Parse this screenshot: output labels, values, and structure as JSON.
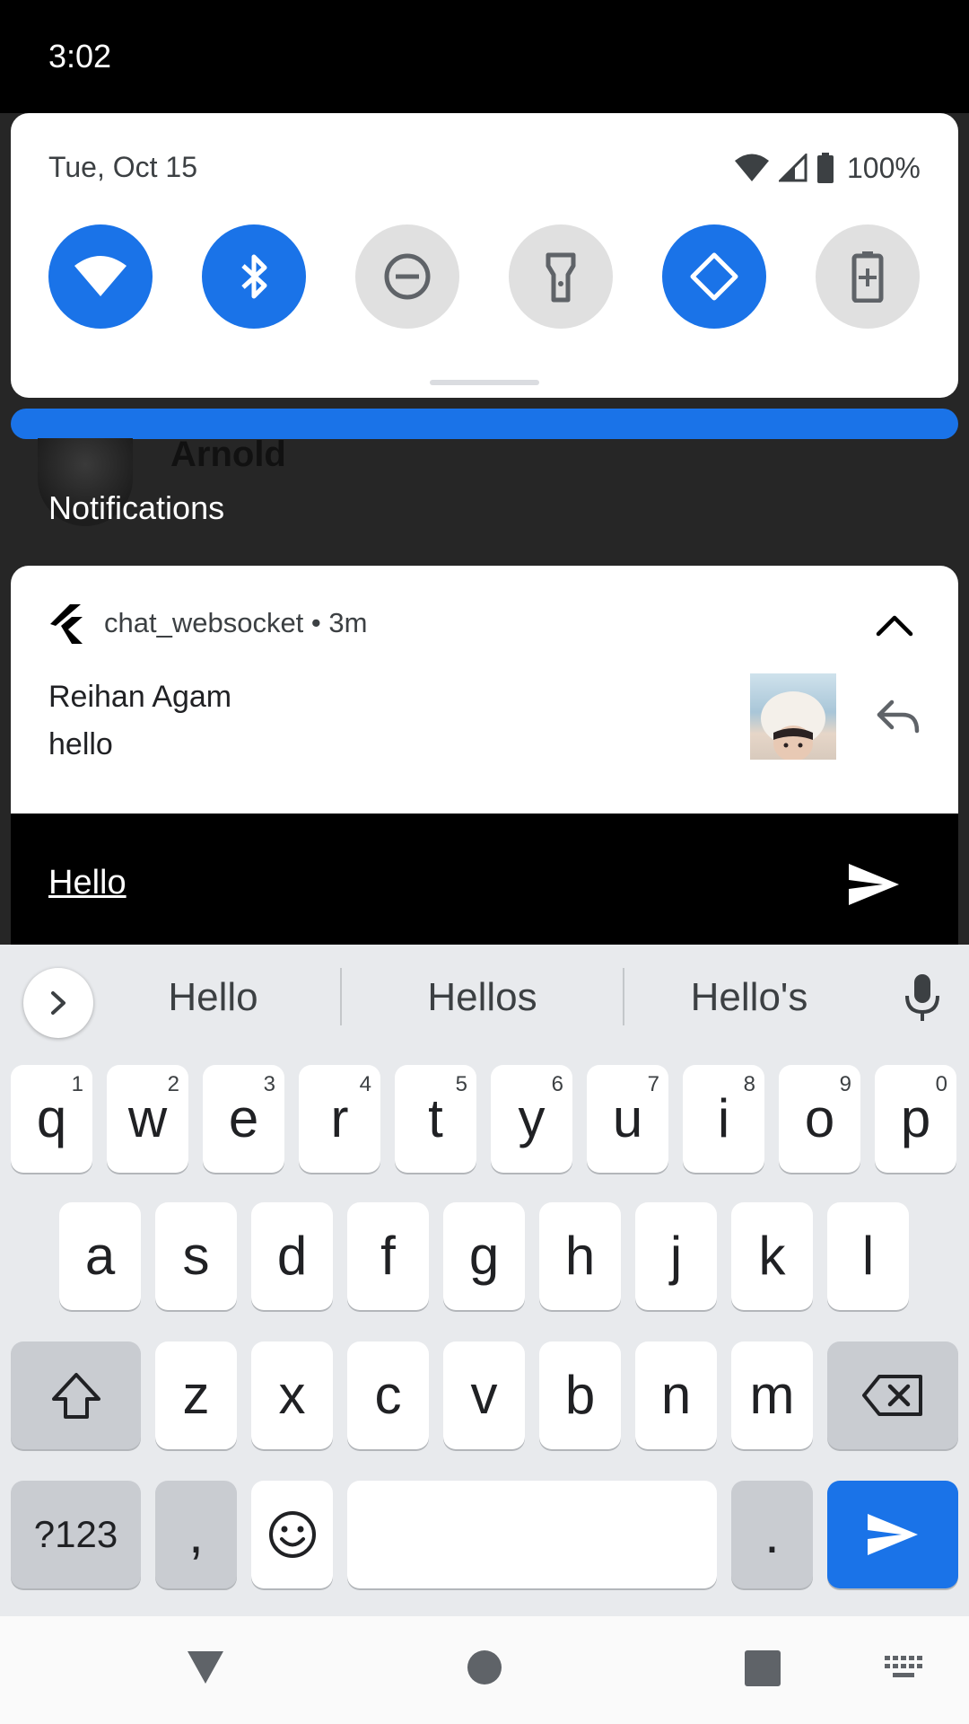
{
  "status_bar": {
    "time": "3:02"
  },
  "quick_settings": {
    "date": "Tue, Oct 15",
    "battery": "100%",
    "tiles": [
      {
        "name": "wifi",
        "on": true
      },
      {
        "name": "bluetooth",
        "on": true
      },
      {
        "name": "do-not-disturb",
        "on": false
      },
      {
        "name": "flashlight",
        "on": false
      },
      {
        "name": "auto-rotate",
        "on": true
      },
      {
        "name": "battery-saver",
        "on": false
      }
    ]
  },
  "background_notification": {
    "name": "Arnold"
  },
  "notifications_header": "Notifications",
  "notification": {
    "app_name": "chat_websocket",
    "separator": " • ",
    "time": "3m",
    "sender": "Reihan Agam",
    "message": "hello"
  },
  "reply": {
    "input_value": "Hello"
  },
  "keyboard": {
    "suggestions": [
      "Hello",
      "Hellos",
      "Hello's"
    ],
    "row1": [
      {
        "k": "q",
        "h": "1"
      },
      {
        "k": "w",
        "h": "2"
      },
      {
        "k": "e",
        "h": "3"
      },
      {
        "k": "r",
        "h": "4"
      },
      {
        "k": "t",
        "h": "5"
      },
      {
        "k": "y",
        "h": "6"
      },
      {
        "k": "u",
        "h": "7"
      },
      {
        "k": "i",
        "h": "8"
      },
      {
        "k": "o",
        "h": "9"
      },
      {
        "k": "p",
        "h": "0"
      }
    ],
    "row2": [
      "a",
      "s",
      "d",
      "f",
      "g",
      "h",
      "j",
      "k",
      "l"
    ],
    "row3": [
      "z",
      "x",
      "c",
      "v",
      "b",
      "n",
      "m"
    ],
    "symbols_label": "?123",
    "comma": ",",
    "period": "."
  },
  "colors": {
    "accent": "#1a73e8",
    "keyboard_bg": "#e8eaed",
    "function_key": "#c9ccd1"
  }
}
